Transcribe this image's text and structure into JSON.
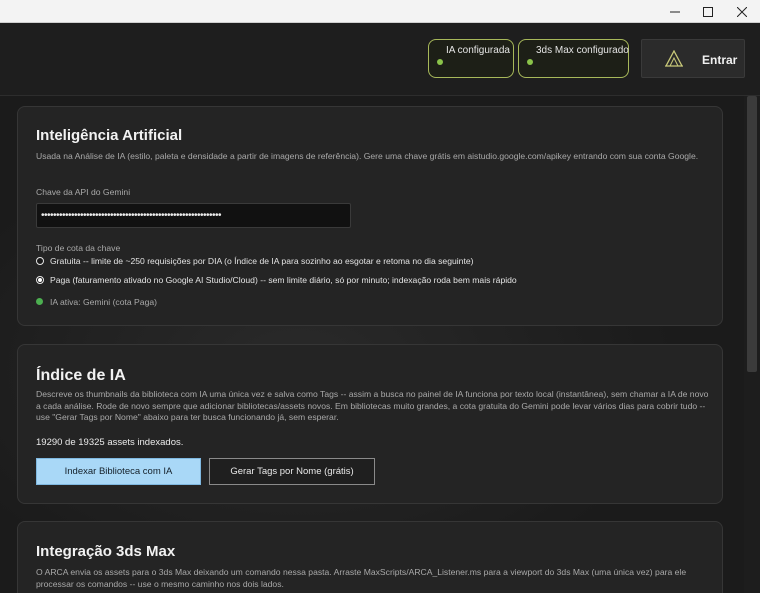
{
  "window": {
    "minimize": "minimize-icon",
    "maximize": "maximize-icon",
    "close": "close-icon"
  },
  "header": {
    "status_ai": "IA configurada",
    "status_max": "3ds Max configurado",
    "login_label": "Entrar",
    "status_color": "#8bc34a"
  },
  "ai_card": {
    "title": "Inteligência Artificial",
    "description": "Usada na Análise de IA (estilo, paleta e densidade a partir de imagens de referência). Gere uma chave grátis em aistudio.google.com/apikey entrando com sua conta Google.",
    "api_label": "Chave da API do Gemini",
    "api_value": "••••••••••••••••••••••••••••••••••••••••••••••••••••••••••••",
    "quota_label": "Tipo de cota da chave",
    "options": [
      {
        "label": "Gratuita -- limite de ~250 requisições por DIA (o Índice de IA para sozinho ao esgotar e retoma no dia seguinte)",
        "checked": false
      },
      {
        "label": "Paga (faturamento ativado no Google AI Studio/Cloud) -- sem limite diário, só por minuto; indexação roda bem mais rápido",
        "checked": true
      }
    ],
    "active_status": "IA ativa: Gemini (cota Paga)"
  },
  "index_card": {
    "title": "Índice de IA",
    "description": "Descreve os thumbnails da biblioteca com IA uma única vez e salva como Tags -- assim a busca no painel de IA funciona por texto local (instantânea), sem chamar a IA de novo a cada análise. Rode de novo sempre que adicionar bibliotecas/assets novos. Em bibliotecas muito grandes, a cota gratuita do Gemini pode levar vários dias para cobrir tudo -- use \"Gerar Tags por Nome\" abaixo para ter busca funcionando já, sem esperar.",
    "count_text": "19290 de 19325 assets indexados.",
    "primary_button": "Indexar Biblioteca com IA",
    "secondary_button": "Gerar Tags por Nome (grátis)"
  },
  "max_card": {
    "title": "Integração 3ds Max",
    "description": "O ARCA envia os assets para o 3ds Max deixando um comando nessa pasta. Arraste MaxScripts/ARCA_Listener.ms para a viewport do 3ds Max (uma única vez) para ele processar os comandos -- use o mesmo caminho nos dois lados."
  }
}
